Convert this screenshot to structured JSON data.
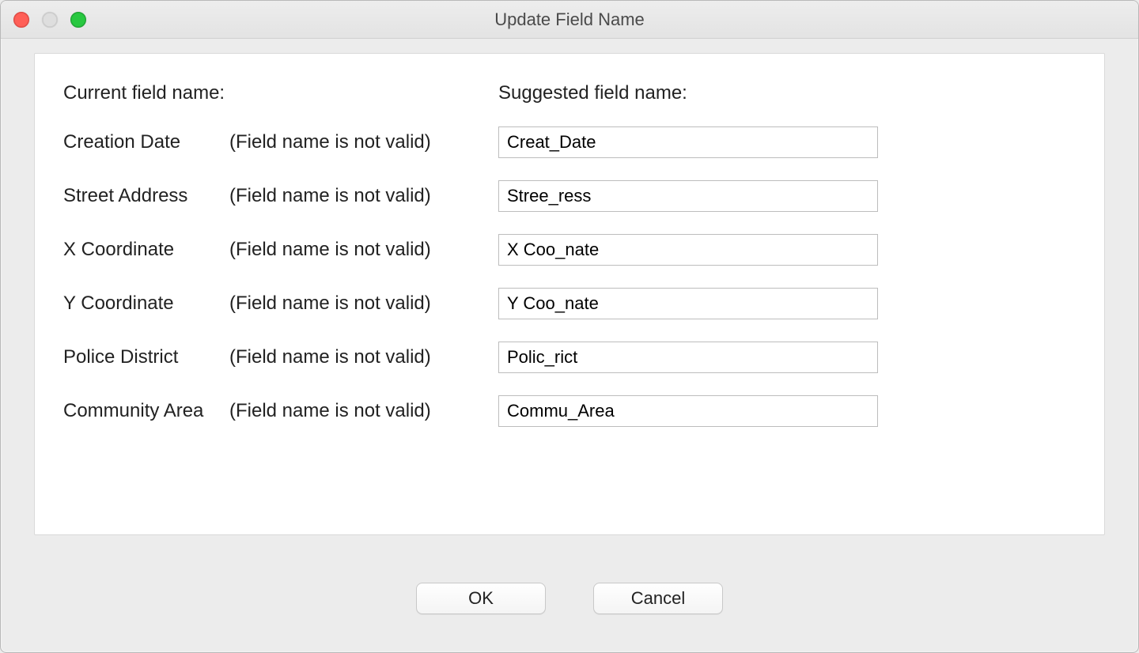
{
  "window": {
    "title": "Update Field Name"
  },
  "headers": {
    "current": "Current field name:",
    "suggested": "Suggested field name:"
  },
  "validation_msg": "(Field name is not valid)",
  "rows": [
    {
      "current": "Creation Date",
      "suggested": "Creat_Date"
    },
    {
      "current": "Street Address",
      "suggested": "Stree_ress"
    },
    {
      "current": "X Coordinate",
      "suggested": "X Coo_nate"
    },
    {
      "current": "Y Coordinate",
      "suggested": "Y Coo_nate"
    },
    {
      "current": "Police District",
      "suggested": "Polic_rict"
    },
    {
      "current": "Community Area",
      "suggested": "Commu_Area"
    }
  ],
  "buttons": {
    "ok": "OK",
    "cancel": "Cancel"
  }
}
